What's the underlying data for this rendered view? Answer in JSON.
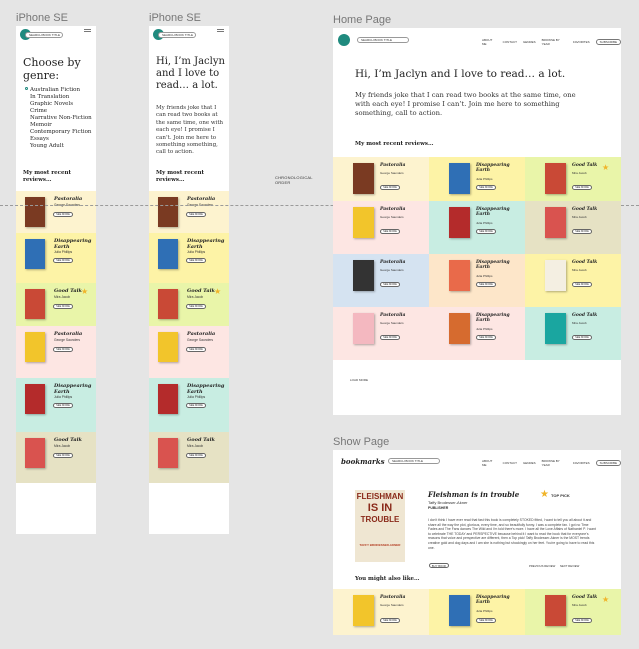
{
  "labels": {
    "iphone_a": "iPhone SE",
    "iphone_b": "iPhone SE",
    "home": "Home Page",
    "show": "Show Page",
    "chron_note": "CHRONOLOGICAL\nORDER"
  },
  "search": {
    "placeholder": "SEARCH BOOK TITLE"
  },
  "nav": [
    "ABOUT ME",
    "CONTACT",
    "GENRES",
    "BROWSE BY YEAR",
    "FAVORITES"
  ],
  "nav_cta": "SUBSCRIBE",
  "brand": "bookmarks",
  "genre": {
    "heading": "Choose by genre:",
    "items": [
      "Australian Fiction",
      "In Translation",
      "Graphic Novels",
      "Crime",
      "Narrative Non-Fiction",
      "Memoir",
      "Contemporary Fiction",
      "Essays",
      "Young Adult"
    ]
  },
  "hero": {
    "title": "Hi, I’m Jaclyn and I love to read… a lot.",
    "body": "My friends joke that I can read two books at the same time, one with each eye!  I promise I can’t. Join me here to something something, call to action."
  },
  "recent_heading": "My most recent reviews…",
  "button_label": "SEE MORE",
  "books": [
    {
      "title": "Pastoralia",
      "author": "George Saunders",
      "bg": "#fdf3cf",
      "cover": "#7a3a22",
      "star": false
    },
    {
      "title": "Disappearing Earth",
      "author": "Julia Phillips",
      "bg": "#fdf3a6",
      "cover": "#2f6fb5",
      "star": false
    },
    {
      "title": "Good Talk",
      "author": "Mira Jacob",
      "bg": "#e9f5a9",
      "cover": "#c94936",
      "star": true
    },
    {
      "title": "Pastoralia",
      "author": "George Saunders",
      "bg": "#fde6e3",
      "cover": "#f2c52b",
      "star": false
    },
    {
      "title": "Disappearing Earth",
      "author": "Julia Phillips",
      "bg": "#c8ede2",
      "cover": "#b42b2b",
      "star": false
    },
    {
      "title": "Good Talk",
      "author": "Mira Jacob",
      "bg": "#e6e2c4",
      "cover": "#d9534f",
      "star": false
    }
  ],
  "home_grid": [
    {
      "title": "Pastoralia",
      "author": "George Saunders",
      "bg": "#fdf3cf",
      "cover": "#7a3a22",
      "star": false
    },
    {
      "title": "Disappearing Earth",
      "author": "Julia Phillips",
      "bg": "#fdf3a6",
      "cover": "#2f6fb5",
      "star": false
    },
    {
      "title": "Good Talk",
      "author": "Mira Jacob",
      "bg": "#e9f5a9",
      "cover": "#c94936",
      "star": true
    },
    {
      "title": "Pastoralia",
      "author": "George Saunders",
      "bg": "#fde6e3",
      "cover": "#f2c52b",
      "star": false
    },
    {
      "title": "Disappearing Earth",
      "author": "Julia Phillips",
      "bg": "#c8ede2",
      "cover": "#b42b2b",
      "star": false
    },
    {
      "title": "Good Talk",
      "author": "Mira Jacob",
      "bg": "#e6e2c4",
      "cover": "#d9534f",
      "star": false
    },
    {
      "title": "Pastoralia",
      "author": "George Saunders",
      "bg": "#d5e3f1",
      "cover": "#333333",
      "star": false
    },
    {
      "title": "Disappearing Earth",
      "author": "Julia Phillips",
      "bg": "#fde6c9",
      "cover": "#e96a4a",
      "star": false
    },
    {
      "title": "Good Talk",
      "author": "Mira Jacob",
      "bg": "#fdf3a6",
      "cover": "#f4efe2",
      "star": false
    },
    {
      "title": "Pastoralia",
      "author": "George Saunders",
      "bg": "#fde6e3",
      "cover": "#f4b8c0",
      "star": false
    },
    {
      "title": "Disappearing Earth",
      "author": "Julia Phillips",
      "bg": "#fde6e3",
      "cover": "#d66b2f",
      "star": false
    },
    {
      "title": "Good Talk",
      "author": "Mira Jacob",
      "bg": "#c8ede2",
      "cover": "#1aa6a0",
      "star": false
    }
  ],
  "home_footer": "LOAD MORE",
  "show": {
    "book_title": "Fleishman is in trouble",
    "author": "Taffy Brodesser-Akner",
    "publisher": "PUBLISHER",
    "top_pick": "TOP PICK",
    "review": "I don't think I have ever read that fast this book is completely STOKED fitted, I want to tell you all about it and share all the way the plot, glorious, every time, and so beautifully funny. I was a complete fan. I got no Time Fades and The Fans dances The Wild and I'm told there's more. I have all the Love Affairs of Nathaniel P. I want to celebrate THE TODAY and PERSPECTIVE because behind it I want to read the book that for everyone's reasons that voice and perspective are different, then a Top pick! Taffy Brodesser-Akner is the MOST trends creative gold and dog days and I am she is nothing but shockingly on her feet. You're going to have to read this one.",
    "buy_label": "BUY BOOK",
    "prev_label": "PREVIOUS REVIEW",
    "next_label": "NEXT REVIEW",
    "also_like": "You might also like…",
    "cover_lines": [
      "FLEISHMAN",
      "IS IN",
      "TROUBLE",
      "TAFFY BRODESSER-AKNER"
    ]
  },
  "show_row": [
    {
      "title": "Pastoralia",
      "author": "George Saunders",
      "bg": "#fdf3cf",
      "cover": "#f2c52b",
      "star": false
    },
    {
      "title": "Disappearing Earth",
      "author": "Julia Phillips",
      "bg": "#fdf3a6",
      "cover": "#2f6fb5",
      "star": false
    },
    {
      "title": "Good Talk",
      "author": "Mira Jacob",
      "bg": "#e9f5a9",
      "cover": "#c94936",
      "star": true
    }
  ],
  "icons": {
    "star": "star-icon",
    "logo": "logo-dot-icon",
    "menu": "menu-icon",
    "radio": "radio-icon"
  }
}
